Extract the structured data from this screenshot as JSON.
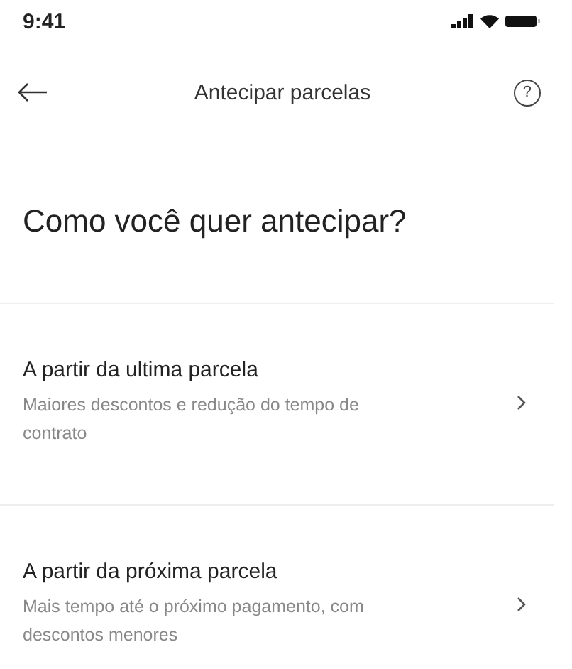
{
  "status_bar": {
    "time": "9:41"
  },
  "header": {
    "title": "Antecipar parcelas",
    "help": "?"
  },
  "heading": "Como você quer antecipar?",
  "options": [
    {
      "title": "A partir da ultima parcela",
      "description": "Maiores descontos e redução do tempo de contrato"
    },
    {
      "title": "A partir da próxima parcela",
      "description": "Mais tempo até o próximo pagamento, com descontos menores"
    }
  ]
}
